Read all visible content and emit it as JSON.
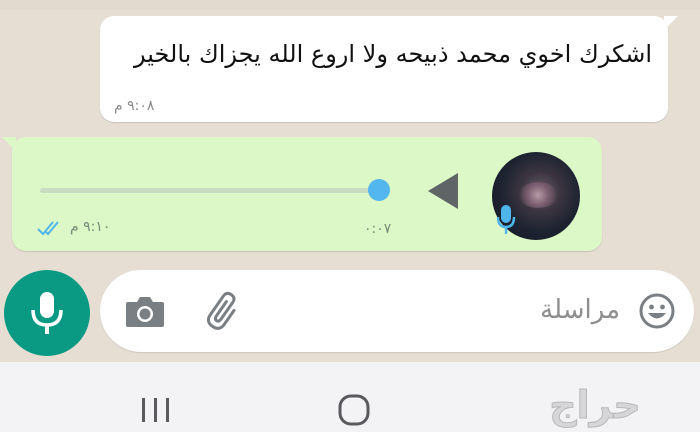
{
  "chat": {
    "incoming": {
      "text": "اشكرك اخوي محمد ذبيحه ولا اروع الله يجزاك بالخير",
      "time": "٩:٠٨ م"
    },
    "voice_note": {
      "duration": "٠:٠٧",
      "time": "٩:١٠ م",
      "status": "read",
      "progress": 1.0,
      "tick_color": "#4fb6ec"
    }
  },
  "composer": {
    "placeholder": "مراسلة"
  },
  "watermark": {
    "text": "حراج"
  },
  "colors": {
    "accent": "#0a9a84",
    "bubble_out": "#dcf8c6",
    "bubble_in": "#ffffff",
    "chat_bg": "#e6ddd3",
    "progress_knob": "#54b6ee"
  }
}
